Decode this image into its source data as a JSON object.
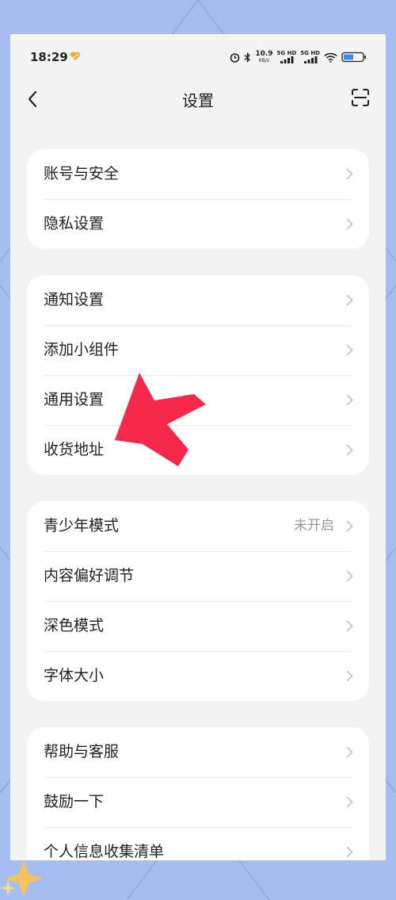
{
  "status": {
    "time": "18:29",
    "speed_value": "10.9",
    "speed_unit": "KB/s",
    "sim1": "5G HD",
    "sim2": "5G HD"
  },
  "header": {
    "title": "设置"
  },
  "groups": [
    {
      "items": [
        {
          "label": "账号与安全"
        },
        {
          "label": "隐私设置"
        }
      ]
    },
    {
      "items": [
        {
          "label": "通知设置"
        },
        {
          "label": "添加小组件"
        },
        {
          "label": "通用设置"
        },
        {
          "label": "收货地址"
        }
      ]
    },
    {
      "items": [
        {
          "label": "青少年模式",
          "value": "未开启"
        },
        {
          "label": "内容偏好调节"
        },
        {
          "label": "深色模式"
        },
        {
          "label": "字体大小"
        }
      ]
    },
    {
      "items": [
        {
          "label": "帮助与客服"
        },
        {
          "label": "鼓励一下"
        },
        {
          "label": "个人信息收集清单"
        }
      ]
    }
  ],
  "colors": {
    "background": "#a6bdf2",
    "annotation_arrow": "#f5284a"
  },
  "icons": [
    "heart-icon",
    "alarm-icon",
    "bluetooth-icon",
    "signal-icon",
    "wifi-icon",
    "battery-icon",
    "back-icon",
    "scan-icon",
    "chevron-right-icon",
    "annotation-arrow"
  ]
}
